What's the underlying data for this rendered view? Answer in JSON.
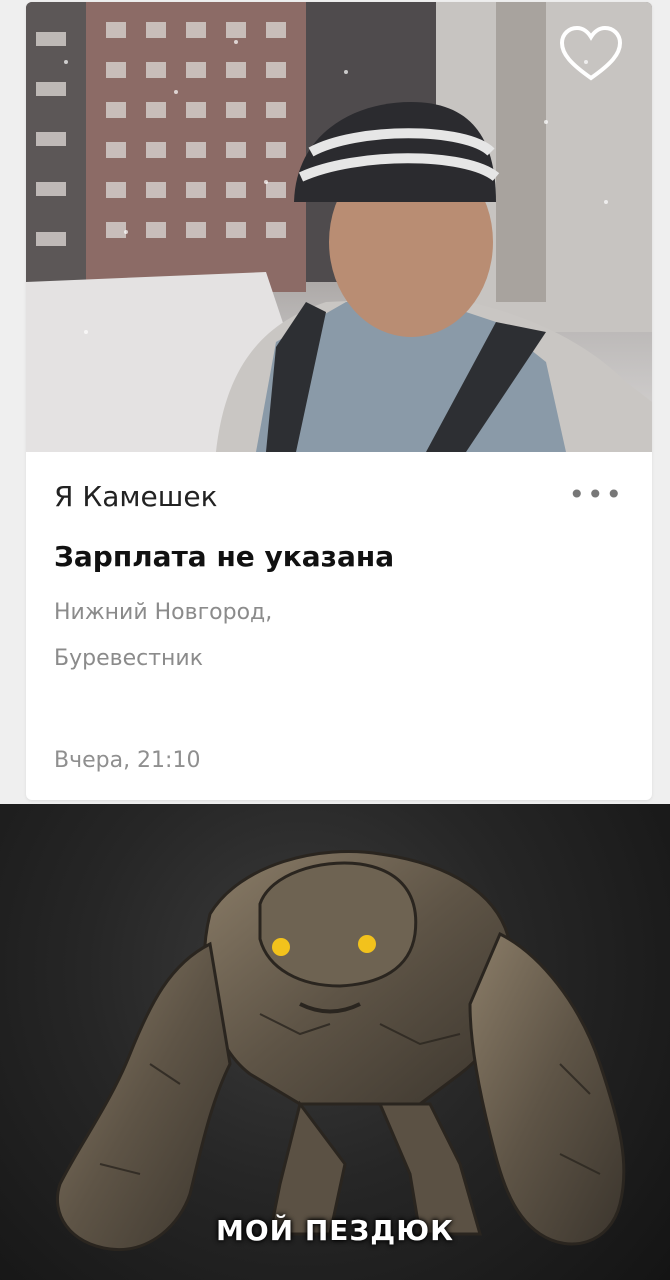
{
  "listing": {
    "title": "Я Камешек",
    "salary": "Зарплата не указана",
    "location_line1": "Нижний Новгород,",
    "location_line2": "Буревестник",
    "posted": "Вчера, 21:10",
    "more_icon": "more-horizontal-icon",
    "favorite_icon": "heart-outline-icon"
  },
  "meme": {
    "caption": "МОЙ ПЕЗДЮК"
  },
  "colors": {
    "card_bg": "#ffffff",
    "page_bg": "#efefef",
    "text_primary": "#222222",
    "text_secondary": "#8b8b8b",
    "meme_bg": "#222222"
  }
}
